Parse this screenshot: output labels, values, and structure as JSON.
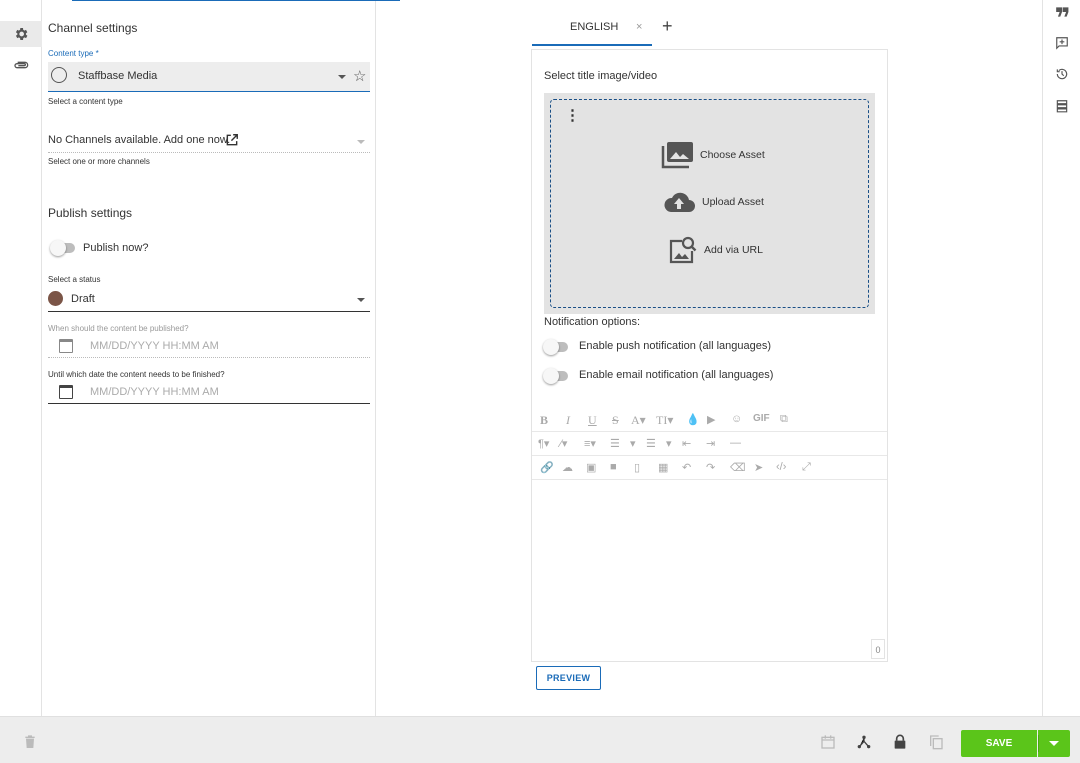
{
  "left_panel": {
    "channel_settings_title": "Channel settings",
    "content_type": {
      "label": "Content type *",
      "value": "Staffbase Media",
      "helper": "Select a content type"
    },
    "channels": {
      "value": "No Channels available. Add one now.",
      "helper": "Select one or more channels"
    },
    "publish_settings_title": "Publish settings",
    "publish_now": {
      "label": "Publish now?",
      "checked": false
    },
    "status": {
      "label": "Select a status",
      "value": "Draft",
      "color": "#7b5547"
    },
    "publish_date": {
      "label": "When should the content be published?",
      "placeholder": "MM/DD/YYYY HH:MM AM"
    },
    "finish_date": {
      "label": "Until which date the content needs to be finished?",
      "placeholder": "MM/DD/YYYY HH:MM AM"
    }
  },
  "editor": {
    "language_tab": "ENGLISH",
    "close_tab_glyph": "×",
    "add_language_glyph": "+",
    "title_image_label": "Select title image/video",
    "asset_actions": {
      "choose": "Choose Asset",
      "upload": "Upload Asset",
      "url": "Add via URL"
    },
    "notification_title": "Notification options:",
    "push_notification": "Enable push notification (all languages)",
    "email_notification": "Enable email notification (all languages)",
    "char_count": "0",
    "toolbar_text": {
      "bold": "B",
      "italic": "I",
      "underline": "U",
      "strike": "S",
      "font_size": "A▾",
      "text_size": "TI▾",
      "gif": "GIF"
    },
    "preview_label": "PREVIEW"
  },
  "bottom_bar": {
    "save_label": "SAVE"
  },
  "colors": {
    "accent": "#1a6bb8",
    "save": "#5bc51a",
    "status_draft": "#7b5547"
  }
}
